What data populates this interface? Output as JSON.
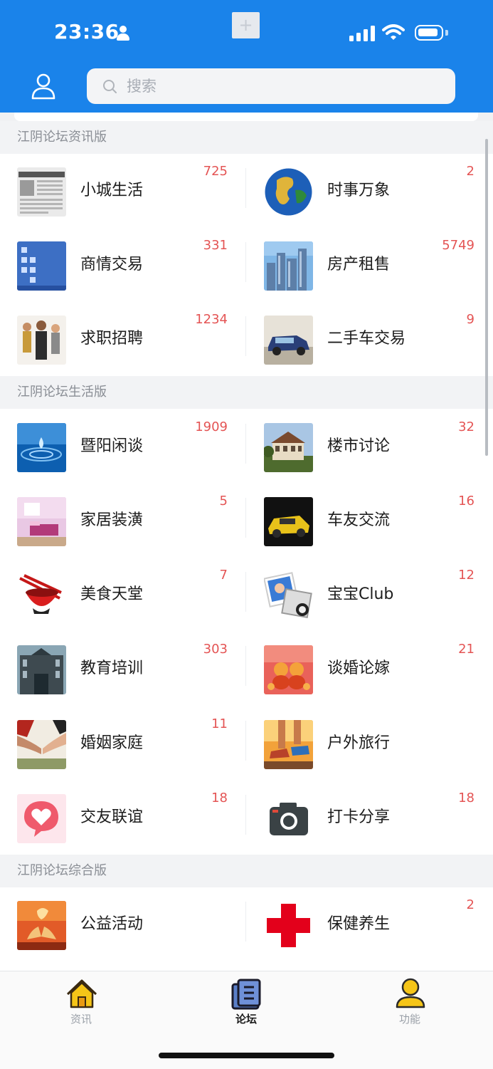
{
  "status_bar": {
    "time": "23:36",
    "colors": {
      "header": "#1a83ea"
    }
  },
  "search": {
    "placeholder": "搜索"
  },
  "sections": [
    {
      "title": "江阴论坛资讯版",
      "items": [
        {
          "name": "小城生活",
          "count": "725",
          "icon": "newspaper-image"
        },
        {
          "name": "时事万象",
          "count": "2",
          "icon": "globe-image"
        },
        {
          "name": "商情交易",
          "count": "331",
          "icon": "windows-screen-image"
        },
        {
          "name": "房产租售",
          "count": "5749",
          "icon": "city-buildings-image"
        },
        {
          "name": "求职招聘",
          "count": "1234",
          "icon": "business-people-image"
        },
        {
          "name": "二手车交易",
          "count": "9",
          "icon": "mini-car-image"
        }
      ]
    },
    {
      "title": "江阴论坛生活版",
      "items": [
        {
          "name": "暨阳闲谈",
          "count": "1909",
          "icon": "water-drop-image"
        },
        {
          "name": "楼市讨论",
          "count": "32",
          "icon": "mansion-image"
        },
        {
          "name": "家居装潢",
          "count": "5",
          "icon": "bedroom-image"
        },
        {
          "name": "车友交流",
          "count": "16",
          "icon": "sports-car-image"
        },
        {
          "name": "美食天堂",
          "count": "7",
          "icon": "bowl-chopsticks-image"
        },
        {
          "name": "宝宝Club",
          "count": "12",
          "icon": "baby-photos-image"
        },
        {
          "name": "教育培训",
          "count": "303",
          "icon": "school-building-image"
        },
        {
          "name": "谈婚论嫁",
          "count": "21",
          "icon": "wedding-dolls-image"
        },
        {
          "name": "婚姻家庭",
          "count": "11",
          "icon": "holding-hands-image"
        },
        {
          "name": "户外旅行",
          "count": "",
          "icon": "running-shoes-image"
        },
        {
          "name": "交友联谊",
          "count": "18",
          "icon": "heart-chat-icon"
        },
        {
          "name": "打卡分享",
          "count": "18",
          "icon": "camera-icon"
        }
      ]
    },
    {
      "title": "江阴论坛综合版",
      "items": [
        {
          "name": "公益活动",
          "count": "",
          "icon": "charity-hands-image"
        },
        {
          "name": "保健养生",
          "count": "2",
          "icon": "red-cross-image"
        }
      ]
    }
  ],
  "tabs": [
    {
      "label": "资讯",
      "icon": "home-icon",
      "active": false
    },
    {
      "label": "论坛",
      "icon": "book-icon",
      "active": true
    },
    {
      "label": "功能",
      "icon": "person-icon",
      "active": false
    }
  ]
}
